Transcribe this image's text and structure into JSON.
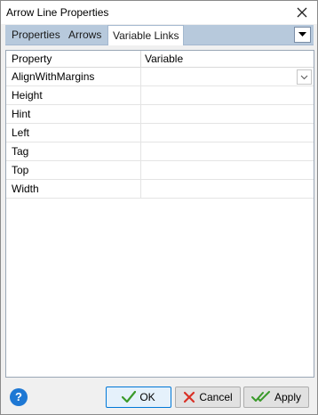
{
  "window": {
    "title": "Arrow Line Properties"
  },
  "tabs": [
    {
      "label": "Properties"
    },
    {
      "label": "Arrows"
    },
    {
      "label": "Variable Links",
      "active": true
    }
  ],
  "grid": {
    "headers": {
      "property": "Property",
      "variable": "Variable"
    },
    "rows": [
      {
        "property": "AlignWithMargins",
        "variable": ""
      },
      {
        "property": "Height",
        "variable": ""
      },
      {
        "property": "Hint",
        "variable": ""
      },
      {
        "property": "Left",
        "variable": ""
      },
      {
        "property": "Tag",
        "variable": ""
      },
      {
        "property": "Top",
        "variable": ""
      },
      {
        "property": "Width",
        "variable": ""
      }
    ]
  },
  "footer": {
    "help_label": "?",
    "ok_label": "OK",
    "cancel_label": "Cancel",
    "apply_label": "Apply"
  },
  "icons": {
    "close": "close-icon",
    "tab_menu": "chevron-down-icon",
    "help": "help-icon",
    "ok": "check-icon",
    "cancel": "x-icon",
    "apply": "double-check-icon"
  },
  "colors": {
    "tabbar": "#b7c9dc",
    "help": "#1e78d4",
    "ok_check": "#3a9a2a",
    "cancel_x": "#d93025"
  }
}
